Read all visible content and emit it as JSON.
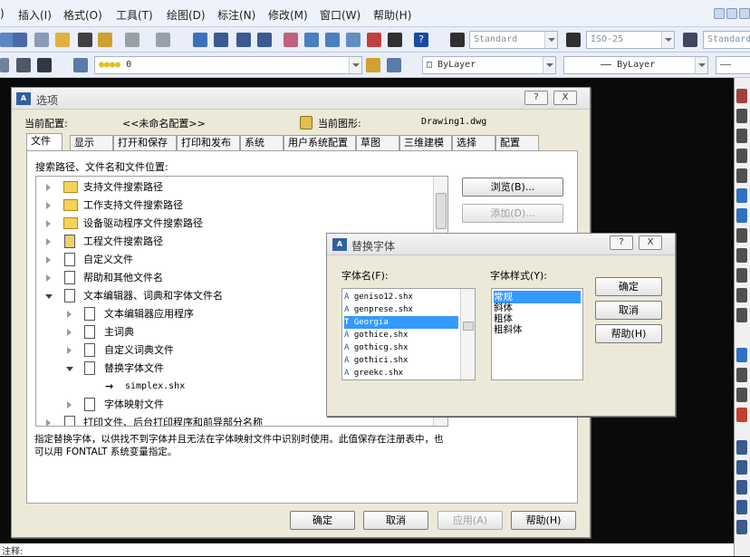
{
  "menu": {
    "items": [
      ")",
      "插入(I)",
      "格式(O)",
      "工具(T)",
      "绘图(D)",
      "标注(N)",
      "修改(M)",
      "窗口(W)",
      "帮助(H)"
    ]
  },
  "toolbar": {
    "text_style": "Standard",
    "dim_style": "ISO-25",
    "table_style": "Standard",
    "layer": "0",
    "color": "ByLayer",
    "linetype": "ByLayer"
  },
  "options_dialog": {
    "title": "选项",
    "help_button": "?",
    "close_button": "X",
    "current_profile_label": "当前配置:",
    "current_profile_value": "<<未命名配置>>",
    "current_drawing_label": "当前图形:",
    "current_drawing_value": "Drawing1.dwg",
    "tabs": [
      "文件",
      "显示",
      "打开和保存",
      "打印和发布",
      "系统",
      "用户系统配置",
      "草图",
      "三维建模",
      "选择",
      "配置"
    ],
    "tree_label": "搜索路径、文件名和文件位置:",
    "tree": [
      "支持文件搜索路径",
      "工作支持文件搜索路径",
      "设备驱动程序文件搜索路径",
      "工程文件搜索路径",
      "自定义文件",
      "帮助和其他文件名",
      "文本编辑器、词典和字体文件名",
      "文本编辑器应用程序",
      "主词典",
      "自定义词典文件",
      "替换字体文件",
      "simplex.shx",
      "字体映射文件",
      "打印文件、后台打印程序和前导部分名称"
    ],
    "browse_button": "浏览(B)...",
    "add_button": "添加(D)...",
    "description": "指定替换字体，以供找不到字体并且无法在字体映射文件中识别时使用。此值保存在注册表中，也可以用 FONTALT 系统变量指定。",
    "ok_button": "确定",
    "cancel_button": "取消",
    "apply_button": "应用(A)",
    "help_button2": "帮助(H)"
  },
  "font_dialog": {
    "title": "替换字体",
    "help_button": "?",
    "close_button": "X",
    "font_name_label": "字体名(F):",
    "font_style_label": "字体样式(Y):",
    "fonts": [
      "geniso12.shx",
      "genprese.shx",
      "Georgia",
      "gothice.shx",
      "gothicg.shx",
      "gothici.shx",
      "greekc.shx"
    ],
    "selected_font": "Georgia",
    "styles": [
      "常规",
      "斜体",
      "粗体",
      "粗斜体"
    ],
    "selected_style": "常规",
    "ok_button": "确定",
    "cancel_button": "取消",
    "help_button2": "帮助(H)"
  },
  "command_line": {
    "text": "注释:"
  }
}
